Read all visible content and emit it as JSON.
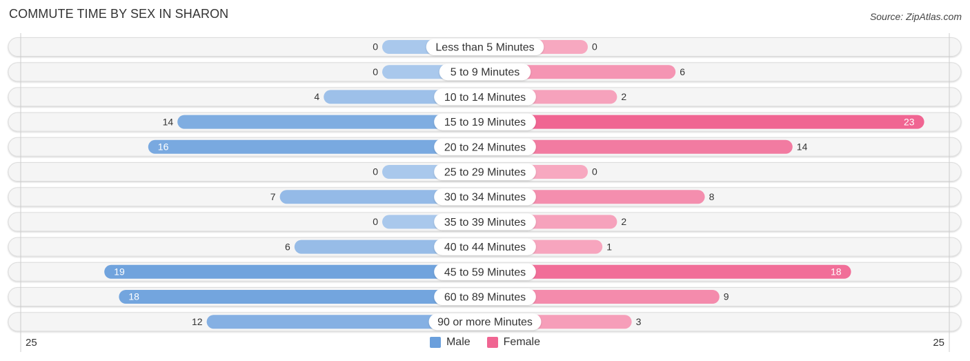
{
  "title": "COMMUTE TIME BY SEX IN SHARON",
  "source": "Source: ZipAtlas.com",
  "legend": [
    {
      "label": "Male",
      "color": "#6a9fdc"
    },
    {
      "label": "Female",
      "color": "#f06592"
    }
  ],
  "axis": {
    "left_label": "25",
    "right_label": "25"
  },
  "chart_data": {
    "type": "bar",
    "orientation": "horizontal-diverging",
    "title": "COMMUTE TIME BY SEX IN SHARON",
    "categories": [
      "Less than 5 Minutes",
      "5 to 9 Minutes",
      "10 to 14 Minutes",
      "15 to 19 Minutes",
      "20 to 24 Minutes",
      "25 to 29 Minutes",
      "30 to 34 Minutes",
      "35 to 39 Minutes",
      "40 to 44 Minutes",
      "45 to 59 Minutes",
      "60 to 89 Minutes",
      "90 or more Minutes"
    ],
    "series": [
      {
        "name": "Male",
        "color": "#6a9fdc",
        "light_color": "#a9c8ec",
        "values": [
          0,
          0,
          4,
          14,
          16,
          0,
          7,
          0,
          6,
          19,
          18,
          12
        ]
      },
      {
        "name": "Female",
        "color": "#f06592",
        "light_color": "#f7a8c0",
        "values": [
          0,
          6,
          2,
          23,
          14,
          0,
          8,
          2,
          1,
          18,
          9,
          3
        ]
      }
    ],
    "xlim": [
      -25,
      25
    ],
    "xlabel": "",
    "ylabel": "",
    "tick_labels": [
      "25",
      "25"
    ],
    "legend_position": "bottom-center",
    "grid": false
  }
}
